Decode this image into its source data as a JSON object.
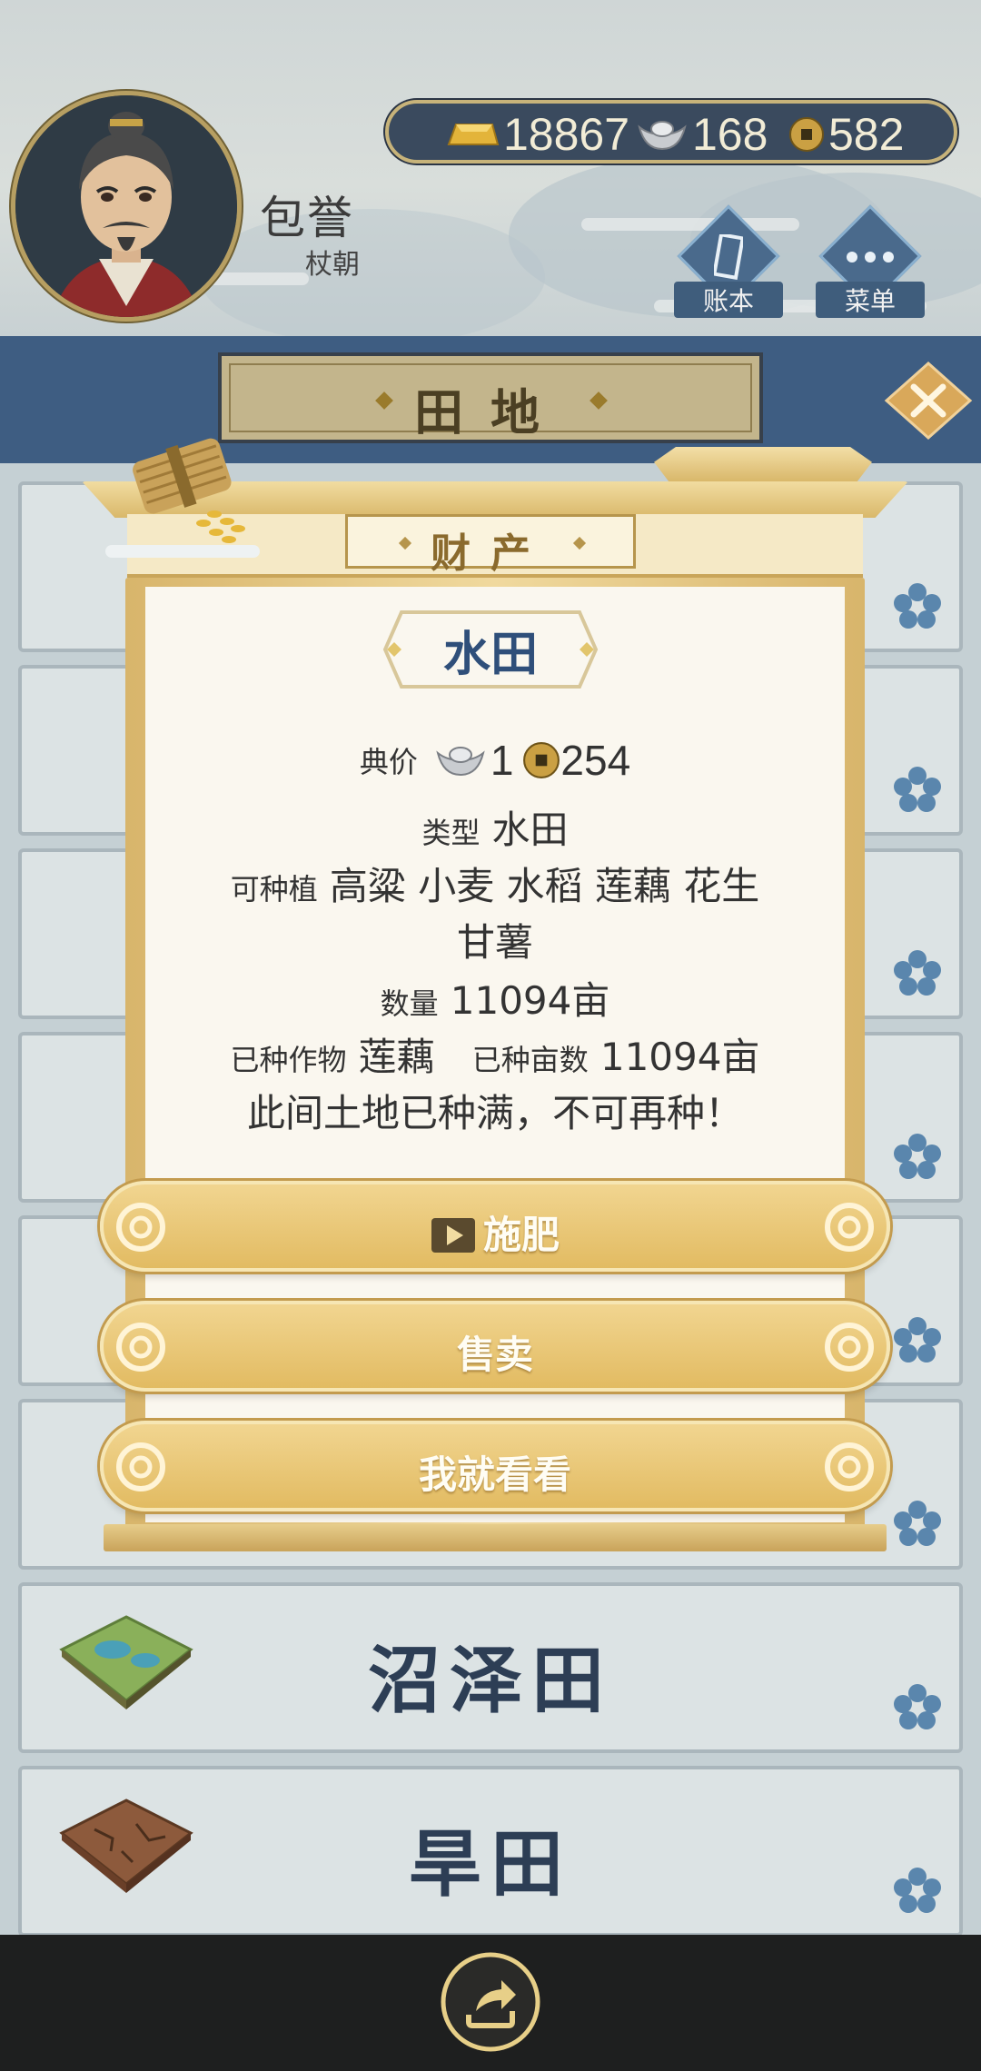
{
  "player": {
    "name": "包誉",
    "dynasty": "杖朝"
  },
  "currency": {
    "gold": "18867",
    "silver": "168",
    "coin": "582"
  },
  "nav": {
    "ledger_label": "账本",
    "menu_label": "菜单"
  },
  "page": {
    "title": "田地"
  },
  "dialog": {
    "header": "财产",
    "land_name": "水田",
    "price_label": "典价",
    "price_silver": "1",
    "price_coin": "254",
    "type_label": "类型",
    "type_value": "水田",
    "plantable_label": "可种植",
    "plantable_value_1": "高粱 小麦 水稻 莲藕 花生",
    "plantable_value_2": "甘薯",
    "quantity_label": "数量",
    "quantity_value": "11094亩",
    "crop_label": "已种作物",
    "crop_value": "莲藕",
    "planted_label": "已种亩数",
    "planted_value": "11094亩",
    "notice": "此间土地已种满，不可再种！",
    "buttons": {
      "fertilize": "施肥",
      "sell": "售卖",
      "just_look": "我就看看"
    }
  },
  "fields": {
    "swamp": "沼泽田",
    "dry": "旱田"
  },
  "colors": {
    "band_blue": "#3e5d82",
    "gold_button": "#e2bb62",
    "dialog_title_blue": "#2f4f7a"
  }
}
